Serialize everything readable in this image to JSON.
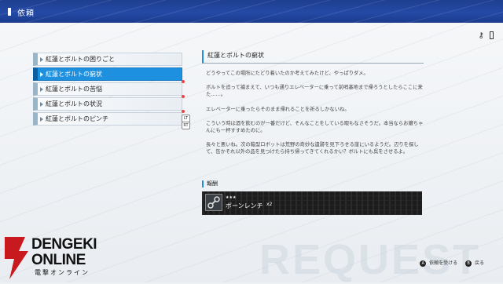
{
  "header": {
    "title": "依頼"
  },
  "tasks": [
    {
      "label": "紅蓮とボルトの困りごと",
      "new": false
    },
    {
      "label": "紅蓮とボルトの窮状",
      "new": false
    },
    {
      "label": "紅蓮とボルトの苦悩",
      "new": true
    },
    {
      "label": "紅蓮とボルトの状況",
      "new": true
    },
    {
      "label": "紅蓮とボルトのピンチ",
      "new": true
    }
  ],
  "shoulder_buttons": {
    "lt": "LT",
    "rt": "RT"
  },
  "detail": {
    "title": "紅蓮とボルトの窮状",
    "paragraphs": [
      "どうやってこの場所にたどり着いたのか考えてみたけど、やっぱりダメ。",
      "ボルトを追って捕まえて、いつも通りエレベーターに乗って前哨基地まで帰ろうとしたらここに来た……。",
      "エレベーターに乗ったらそのまま帰れることを祈るしかないね。",
      "こういう時は酒を飲むのが一番だけど、そんなことをしている暇もなさそうだ。本当ならお嬢ちゃんにも一杯すすめたのに。",
      "長々と悪いね。次の箱型ロボットは荒野の奇妙な遺跡を見下ろせる崖にいるようだ。辺りを探して、缶かそれ以外の品を見つけたら持ち帰ってきてくれるかい？ボルトにも呉をさせるよ。"
    ]
  },
  "reward": {
    "label": "報酬",
    "stars": "★★★",
    "name": "ボーンレンチ",
    "count": "x2"
  },
  "controls": [
    {
      "button": "A",
      "label": "依頼を受ける"
    },
    {
      "button": "B",
      "label": "戻る"
    }
  ],
  "logo": {
    "line1": "DENGEKI",
    "line2": "ONLINE",
    "line3": "電撃オンライン"
  },
  "colors": {
    "header": "#244aa6",
    "selected": "#1e90e0",
    "new_dot": "#e44444"
  },
  "icons": {
    "key": "key-icon",
    "battery": "battery-icon",
    "reward": "wrench-icon"
  }
}
